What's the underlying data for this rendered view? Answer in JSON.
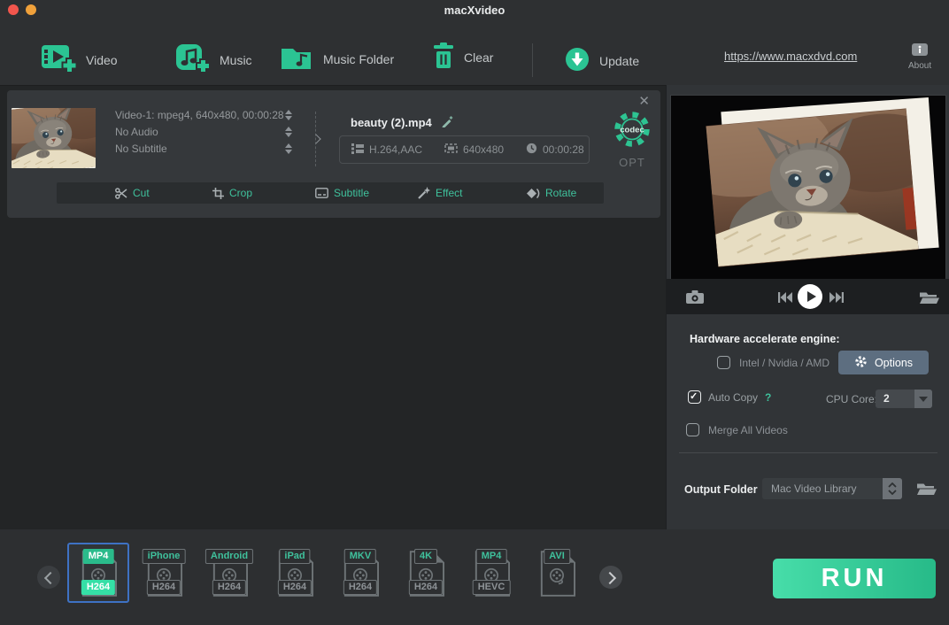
{
  "window": {
    "title": "macXvideo"
  },
  "toolbar": {
    "video": "Video",
    "music": "Music",
    "music_folder": "Music Folder",
    "clear": "Clear",
    "update": "Update",
    "link": "https://www.macxdvd.com",
    "about": "About"
  },
  "media_item": {
    "video_track": "Video-1: mpeg4, 640x480, 00:00:28",
    "audio_track": "No Audio",
    "subtitle_track": "No Subtitle",
    "filename": "beauty (2).mp4",
    "codec": "H.264,AAC",
    "resolution": "640x480",
    "duration": "00:00:28",
    "codec_gear_label": "codec",
    "opt_label": "OPT"
  },
  "edit_toolbar": {
    "cut": "Cut",
    "crop": "Crop",
    "subtitle": "Subtitle",
    "effect": "Effect",
    "rotate": "Rotate"
  },
  "settings": {
    "hardware_title": "Hardware accelerate engine:",
    "hw_checkbox_label": "Intel / Nvidia / AMD",
    "options_label": "Options",
    "auto_copy_label": "Auto Copy",
    "help": "?",
    "cpu_core_label": "CPU Core:",
    "cpu_core_value": "2",
    "merge_label": "Merge All Videos",
    "output_label": "Output Folder",
    "output_value": "Mac Video Library"
  },
  "presets": {
    "run_label": "RUN",
    "items": [
      {
        "format": "MP4",
        "codec": "H264",
        "selected": true
      },
      {
        "format": "iPhone",
        "codec": "H264",
        "selected": false
      },
      {
        "format": "Android",
        "codec": "H264",
        "selected": false
      },
      {
        "format": "iPad",
        "codec": "H264",
        "selected": false
      },
      {
        "format": "MKV",
        "codec": "H264",
        "selected": false
      },
      {
        "format": "4K",
        "codec": "H264",
        "selected": false
      },
      {
        "format": "MP4",
        "codec": "HEVC",
        "selected": false
      },
      {
        "format": "AVI",
        "codec": "",
        "selected": false
      }
    ]
  },
  "colors": {
    "accent": "#2bc493",
    "selected_preset_border": "#3e72c4",
    "options_button": "#5d6e80",
    "run_gradient_start": "#47dda9",
    "run_gradient_end": "#27ba88"
  }
}
